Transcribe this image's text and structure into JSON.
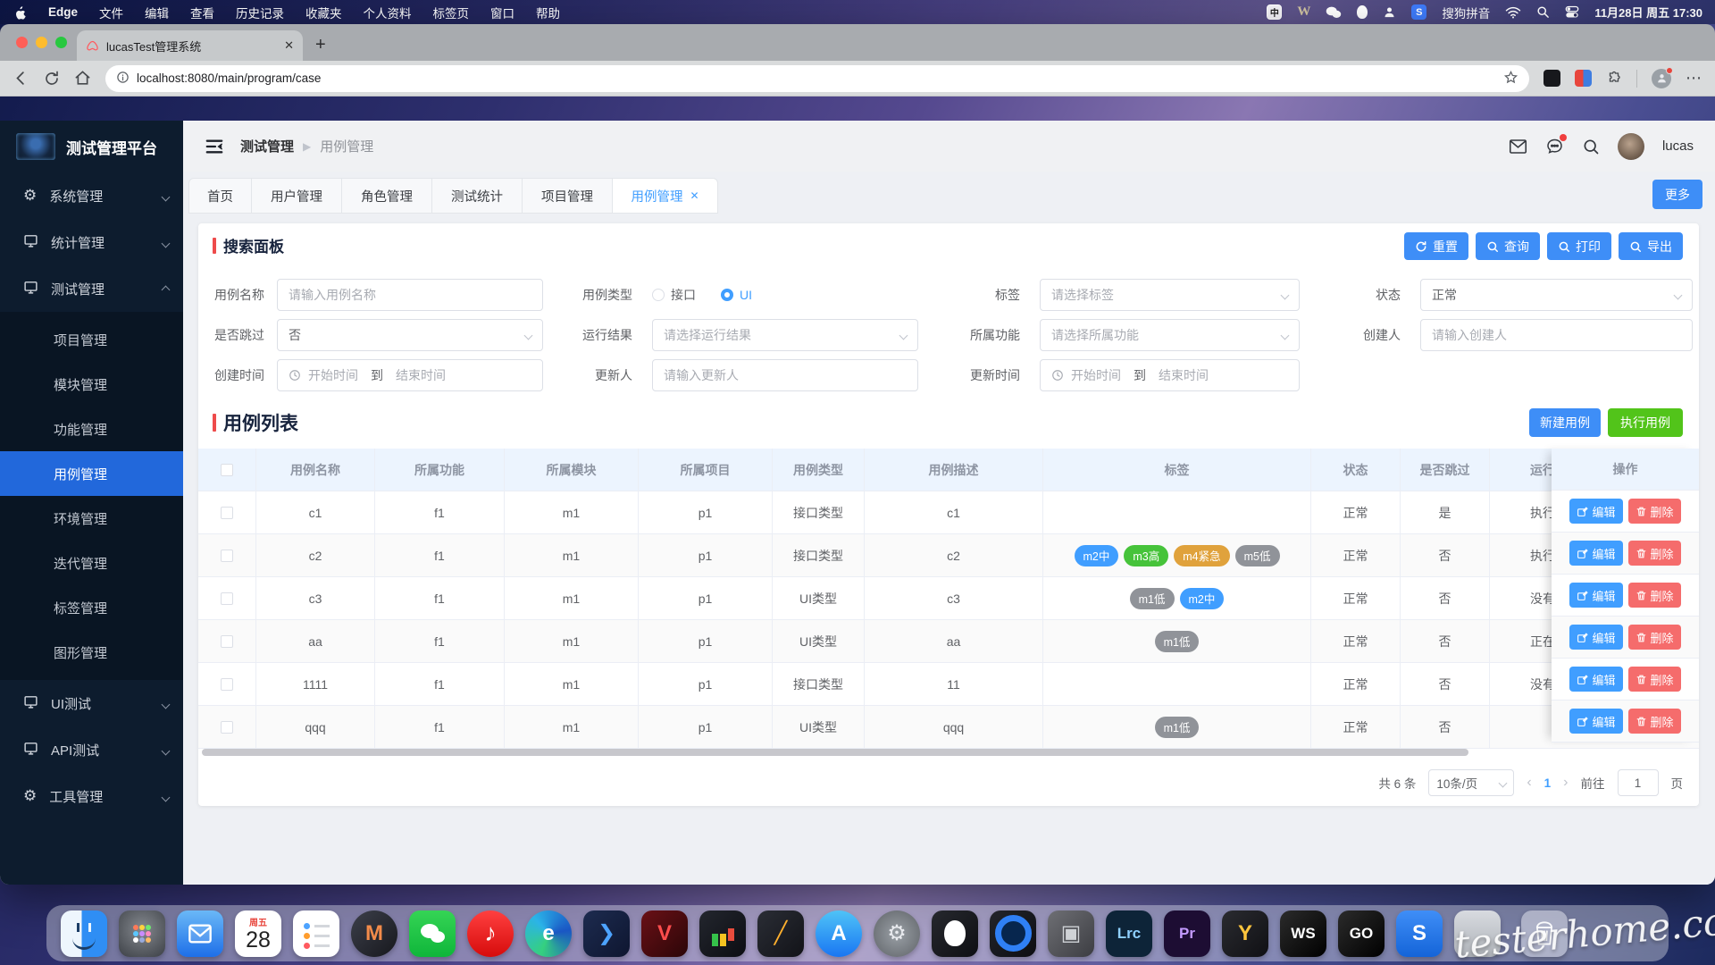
{
  "colors": {
    "accent": "#409eff",
    "button_blue": "#3e8ef7",
    "green": "#52c41a",
    "red_delete": "#f56c6c",
    "sidebar_active": "#2268db",
    "section_bar": "#ee4b4b",
    "tag_blue": "#409eff",
    "tag_green": "#46c33a",
    "tag_orange": "#e0a23c",
    "tag_gray": "#909399"
  },
  "menubar": {
    "app_name": "Edge",
    "menus": [
      "文件",
      "编辑",
      "查看",
      "历史记录",
      "收藏夹",
      "个人资料",
      "标签页",
      "窗口",
      "帮助"
    ],
    "ime_badge": "中",
    "w_badge": "W",
    "ime_name": "搜狗拼音",
    "datetime": "11月28日 周五 17:30"
  },
  "browser": {
    "tab_title": "lucasTest管理系统",
    "url": "localhost:8080/main/program/case"
  },
  "sidebar": {
    "title": "测试管理平台",
    "groups": [
      {
        "label": "系统管理",
        "icon": "gear",
        "expanded": false
      },
      {
        "label": "统计管理",
        "icon": "monitor",
        "expanded": false
      },
      {
        "label": "测试管理",
        "icon": "monitor",
        "expanded": true,
        "children": [
          "项目管理",
          "模块管理",
          "功能管理",
          "用例管理",
          "环境管理",
          "迭代管理",
          "标签管理",
          "图形管理"
        ],
        "active_child": "用例管理"
      },
      {
        "label": "UI测试",
        "icon": "monitor",
        "expanded": false
      },
      {
        "label": "API测试",
        "icon": "monitor",
        "expanded": false
      },
      {
        "label": "工具管理",
        "icon": "gear",
        "expanded": false
      }
    ]
  },
  "topnav": {
    "breadcrumb_1": "测试管理",
    "breadcrumb_2": "用例管理",
    "user": "lucas"
  },
  "tabs": {
    "items": [
      {
        "label": "首页",
        "active": false
      },
      {
        "label": "用户管理",
        "active": false
      },
      {
        "label": "角色管理",
        "active": false
      },
      {
        "label": "测试统计",
        "active": false
      },
      {
        "label": "项目管理",
        "active": false
      },
      {
        "label": "用例管理",
        "active": true,
        "closable": true
      }
    ],
    "more": "更多"
  },
  "search": {
    "title": "搜索面板",
    "actions": [
      {
        "label": "重置",
        "icon": "refresh"
      },
      {
        "label": "查询",
        "icon": "search"
      },
      {
        "label": "打印",
        "icon": "search"
      },
      {
        "label": "导出",
        "icon": "search"
      }
    ],
    "fields": {
      "case_name": {
        "label": "用例名称",
        "placeholder": "请输入用例名称"
      },
      "case_type": {
        "label": "用例类型",
        "options": [
          {
            "label": "接口",
            "selected": false
          },
          {
            "label": "UI",
            "selected": true
          }
        ]
      },
      "tag": {
        "label": "标签",
        "placeholder": "请选择标签"
      },
      "status": {
        "label": "状态",
        "value": "正常"
      },
      "skip": {
        "label": "是否跳过",
        "value": "否"
      },
      "run_result": {
        "label": "运行结果",
        "placeholder": "请选择运行结果"
      },
      "func": {
        "label": "所属功能",
        "placeholder": "请选择所属功能"
      },
      "creator": {
        "label": "创建人",
        "placeholder": "请输入创建人"
      },
      "create_time": {
        "label": "创建时间",
        "start": "开始时间",
        "sep": "到",
        "end": "结束时间"
      },
      "updater": {
        "label": "更新人",
        "placeholder": "请输入更新人"
      },
      "update_time": {
        "label": "更新时间",
        "start": "开始时间",
        "sep": "到",
        "end": "结束时间"
      }
    }
  },
  "list": {
    "title": "用例列表",
    "new_button": "新建用例",
    "exec_button": "执行用例"
  },
  "table": {
    "columns": [
      "",
      "用例名称",
      "所属功能",
      "所属模块",
      "所属项目",
      "用例类型",
      "用例描述",
      "标签",
      "状态",
      "是否跳过",
      "运行结果"
    ],
    "op_label": "操作",
    "edit_label": "编辑",
    "delete_label": "删除",
    "rows": [
      {
        "name": "c1",
        "func": "f1",
        "module": "m1",
        "project": "p1",
        "type": "接口类型",
        "desc": "c1",
        "tags": [],
        "status": "正常",
        "skip": "是",
        "run": "执行"
      },
      {
        "name": "c2",
        "func": "f1",
        "module": "m1",
        "project": "p1",
        "type": "接口类型",
        "desc": "c2",
        "tags": [
          {
            "label": "m2中",
            "color": "#409eff"
          },
          {
            "label": "m3高",
            "color": "#46c33a"
          },
          {
            "label": "m4紧急",
            "color": "#e0a23c"
          },
          {
            "label": "m5低",
            "color": "#909399"
          }
        ],
        "status": "正常",
        "skip": "否",
        "run": "执行"
      },
      {
        "name": "c3",
        "func": "f1",
        "module": "m1",
        "project": "p1",
        "type": "UI类型",
        "desc": "c3",
        "tags": [
          {
            "label": "m1低",
            "color": "#909399"
          },
          {
            "label": "m2中",
            "color": "#409eff"
          }
        ],
        "status": "正常",
        "skip": "否",
        "run": "没有"
      },
      {
        "name": "aa",
        "func": "f1",
        "module": "m1",
        "project": "p1",
        "type": "UI类型",
        "desc": "aa",
        "tags": [
          {
            "label": "m1低",
            "color": "#909399"
          }
        ],
        "status": "正常",
        "skip": "否",
        "run": "正在"
      },
      {
        "name": "1111",
        "func": "f1",
        "module": "m1",
        "project": "p1",
        "type": "接口类型",
        "desc": "11",
        "tags": [],
        "status": "正常",
        "skip": "否",
        "run": "没有"
      },
      {
        "name": "qqq",
        "func": "f1",
        "module": "m1",
        "project": "p1",
        "type": "UI类型",
        "desc": "qqq",
        "tags": [
          {
            "label": "m1低",
            "color": "#909399"
          }
        ],
        "status": "正常",
        "skip": "否",
        "run": ""
      }
    ]
  },
  "pagination": {
    "total": "共 6 条",
    "page_size": "10条/页",
    "current": "1",
    "goto": "前往",
    "goto_value": "1",
    "unit": "页"
  },
  "dock": [
    {
      "name": "finder",
      "kind": "finder"
    },
    {
      "name": "launchpad",
      "kind": "launchpad"
    },
    {
      "name": "mail",
      "kind": "svg",
      "icon": "envelope",
      "bg": "linear-gradient(180deg,#6ab8f7,#1e6fe8)"
    },
    {
      "name": "calendar",
      "kind": "calendar",
      "top": "周五",
      "day": "28"
    },
    {
      "name": "reminders",
      "kind": "reminders"
    },
    {
      "name": "m-app",
      "kind": "label",
      "label": "M",
      "bg": "linear-gradient(135deg,#3c3f4a,#17181d)",
      "fg": "#f38b4a",
      "round": true
    },
    {
      "name": "wechat",
      "kind": "svg",
      "icon": "chat2",
      "bg": "linear-gradient(180deg,#35d455,#0fb63a)"
    },
    {
      "name": "netease-music",
      "kind": "note",
      "label": "♪",
      "bg": "linear-gradient(180deg,#ff4040,#d60c0c)",
      "round": true
    },
    {
      "name": "edge",
      "kind": "label",
      "label": "e",
      "bg": "conic-gradient(from 200deg,#35d07f,#2bb3e8,#1a56c4,#35d07f)",
      "fg": "#ffffff",
      "round": true
    },
    {
      "name": "dark-arrow-app",
      "kind": "label",
      "label": "❯",
      "bg": "linear-gradient(135deg,#1d2b4f,#0e1630)",
      "fg": "#4da3ff"
    },
    {
      "name": "v-app",
      "kind": "label",
      "label": "V",
      "bg": "linear-gradient(135deg,#6a1016,#2b0608)",
      "fg": "#ff4d4d"
    },
    {
      "name": "chart-app",
      "kind": "chart",
      "bg": "linear-gradient(135deg,#23262e,#0c0d12)"
    },
    {
      "name": "pencil-app",
      "kind": "label",
      "label": "╱",
      "bg": "linear-gradient(135deg,#2a2d35,#121318)",
      "fg": "#ffb02e"
    },
    {
      "name": "app-store",
      "kind": "label",
      "label": "A",
      "bg": "linear-gradient(180deg,#4fc3f7,#1976f2)",
      "fg": "#ffffff",
      "round": true
    },
    {
      "name": "settings",
      "kind": "label",
      "label": "⚙",
      "bg": "radial-gradient(circle,#9aa0a6,#5f6368)",
      "fg": "#e8eaee",
      "round": true
    },
    {
      "name": "qq",
      "kind": "penguin",
      "bg": "linear-gradient(135deg,#26282e,#0e0f13)"
    },
    {
      "name": "ring-app",
      "kind": "ring",
      "bg": "linear-gradient(135deg,#23252b,#0d0e12)"
    },
    {
      "name": "box-app",
      "kind": "label",
      "label": "▣",
      "bg": "linear-gradient(135deg,#6e6f74,#3c3d42)",
      "fg": "#cfd2d6"
    },
    {
      "name": "lightroom-classic",
      "kind": "label",
      "label": "Lrc",
      "bg": "#0d2438",
      "fg": "#8fd0ff",
      "small": true
    },
    {
      "name": "premiere-pro",
      "kind": "label",
      "label": "Pr",
      "bg": "#1d0d33",
      "fg": "#c49bff",
      "small": true
    },
    {
      "name": "yellow-app",
      "kind": "label",
      "label": "Y",
      "bg": "linear-gradient(135deg,#2a2b30,#101014)",
      "fg": "#ffc53d"
    },
    {
      "name": "webstorm",
      "kind": "label",
      "label": "WS",
      "bg": "linear-gradient(135deg,#2b2b2b,#000000)",
      "fg": "#ffffff",
      "small": true
    },
    {
      "name": "goland",
      "kind": "label",
      "label": "GO",
      "bg": "linear-gradient(135deg,#2b2b2b,#000000)",
      "fg": "#ffffff",
      "small": true
    },
    {
      "name": "blue-s-app",
      "kind": "label",
      "label": "S",
      "bg": "linear-gradient(180deg,#3f8ef7,#1464d8)",
      "fg": "#ffffff"
    },
    {
      "name": "window-app",
      "kind": "label",
      "label": "",
      "bg": "linear-gradient(180deg,#d8dbe0,#aeb2b8)",
      "fg": "#666666"
    },
    {
      "name": "trash",
      "kind": "trash"
    }
  ],
  "watermark": "testerhome.com"
}
